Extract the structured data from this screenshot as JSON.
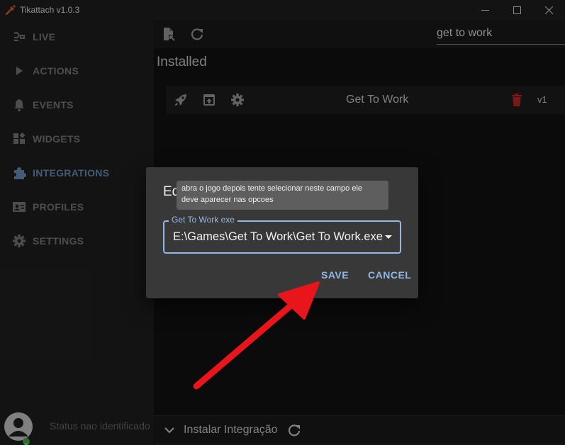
{
  "window": {
    "title": "Tikattach v1.0.3",
    "controls": [
      "minimize-icon",
      "maximize-icon",
      "close-icon"
    ]
  },
  "sidebar": {
    "items": [
      {
        "label": "LIVE",
        "icon": "live-icon",
        "active": false
      },
      {
        "label": "ACTIONS",
        "icon": "play-icon",
        "active": false
      },
      {
        "label": "EVENTS",
        "icon": "bell-icon",
        "active": false
      },
      {
        "label": "WIDGETS",
        "icon": "widgets-icon",
        "active": false
      },
      {
        "label": "INTEGRATIONS",
        "icon": "puzzle-icon",
        "active": true
      },
      {
        "label": "PROFILES",
        "icon": "profile-card-icon",
        "active": false
      },
      {
        "label": "SETTINGS",
        "icon": "gear-icon",
        "active": false
      }
    ],
    "status_text": "Status nao identificado"
  },
  "toolbar": {
    "search_value": "get to work"
  },
  "main": {
    "section_title": "Installed",
    "integration": {
      "name": "Get To Work",
      "version": "v1"
    }
  },
  "bottom_bar": {
    "label": "Instalar Integração"
  },
  "dialog": {
    "title": "Ed",
    "tooltip_line1": "abra o jogo depois tente selecionar neste campo ele",
    "tooltip_line2": "deve aparecer nas opcoes",
    "field_label": "Get To Work exe",
    "field_value": "E:\\Games\\Get To Work\\Get To Work.exe",
    "save_label": "SAVE",
    "cancel_label": "CANCEL"
  },
  "colors": {
    "accent": "#90b8e8",
    "active_nav": "#6c93bd",
    "delete": "#c62828",
    "annotation_arrow": "#e8151b"
  }
}
